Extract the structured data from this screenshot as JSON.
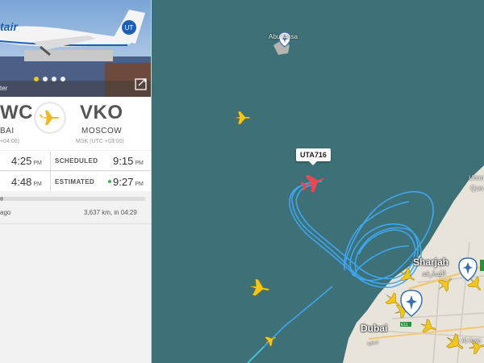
{
  "photo": {
    "airline_logo": "tair",
    "tail_logo": "UT",
    "credit_fragment": "ter"
  },
  "origin": {
    "code": "WC",
    "city": "BAI",
    "tz": "+04:00)"
  },
  "destination": {
    "code": "VKO",
    "city": "MOSCOW",
    "tz": "MSK (UTC +03:00)"
  },
  "times": {
    "scheduled_label": "SCHEDULED",
    "estimated_label": "ESTIMATED",
    "dep_scheduled": "4:25",
    "dep_estimated": "4:48",
    "arr_scheduled": "9:15",
    "arr_estimated": "9:27",
    "pm": "PM"
  },
  "progress": {
    "fraction": 0.02,
    "left_text": "ago",
    "right_text": "3,637 km, in 04:29"
  },
  "map": {
    "callsign": "UTA716",
    "labels": {
      "abu_musa": "Abu Musa",
      "sharjah": "Sharjah",
      "sharjah_ar": "الشارقة",
      "dubai": "Dubai",
      "dubai_ar": "دبي",
      "umm": "Umm",
      "quwain": "Quw",
      "al_awir": "Al Awe",
      "road_e611": "E11"
    },
    "colors": {
      "sea": "#3d7177",
      "land": "#e9e4da",
      "track": "#3fa9f5",
      "selected_plane": "#e8484f",
      "plane": "#f5c518"
    }
  }
}
